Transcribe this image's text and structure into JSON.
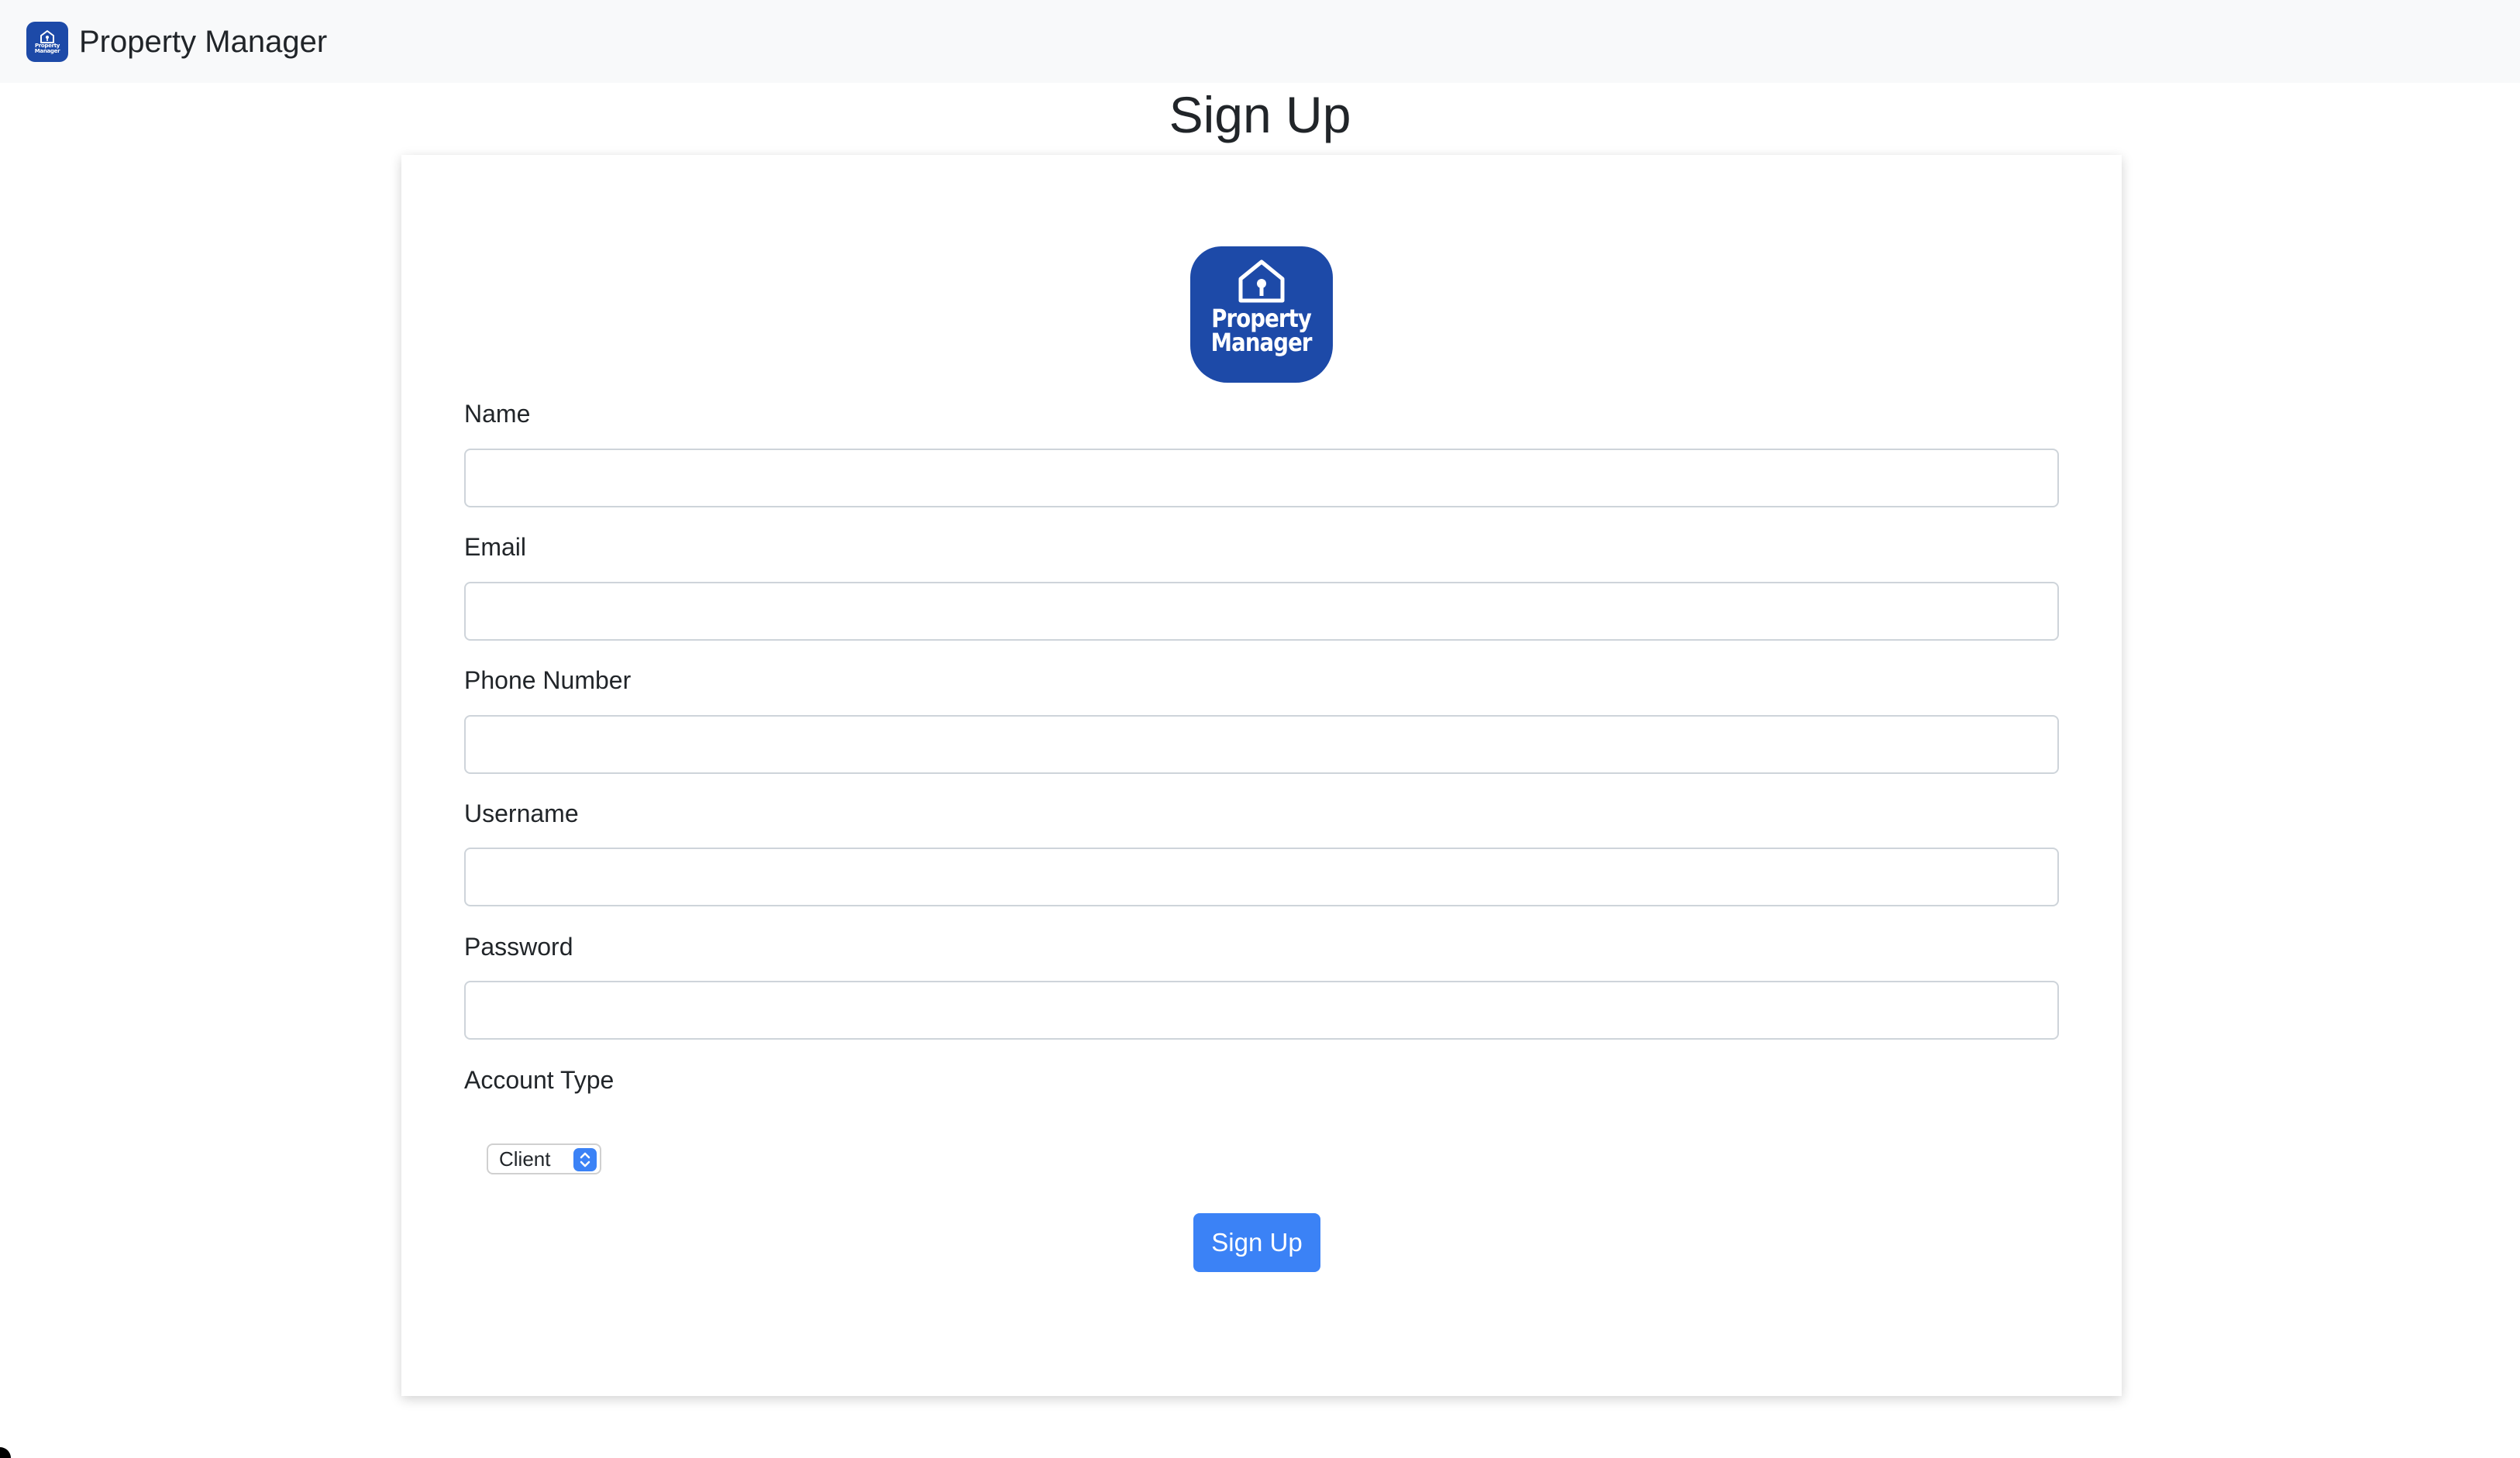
{
  "navbar": {
    "brand_name": "Property Manager",
    "logo_icon": "house-keyhole-icon",
    "logo_text_line1": "Property",
    "logo_text_line2": "Manager"
  },
  "page": {
    "title": "Sign Up"
  },
  "form": {
    "logo_icon": "house-keyhole-icon",
    "logo_text_line1": "Property",
    "logo_text_line2": "Manager",
    "fields": [
      {
        "label": "Name",
        "value": ""
      },
      {
        "label": "Email",
        "value": ""
      },
      {
        "label": "Phone Number",
        "value": ""
      },
      {
        "label": "Username",
        "value": ""
      },
      {
        "label": "Password",
        "value": ""
      }
    ],
    "account_type": {
      "label": "Account Type",
      "selected": "Client",
      "arrow_icon": "select-updown-icon"
    },
    "submit_label": "Sign Up"
  },
  "colors": {
    "brand_blue": "#1d4aa8",
    "button_blue": "#3b82f6",
    "navbar_bg": "#f8f9fa"
  }
}
